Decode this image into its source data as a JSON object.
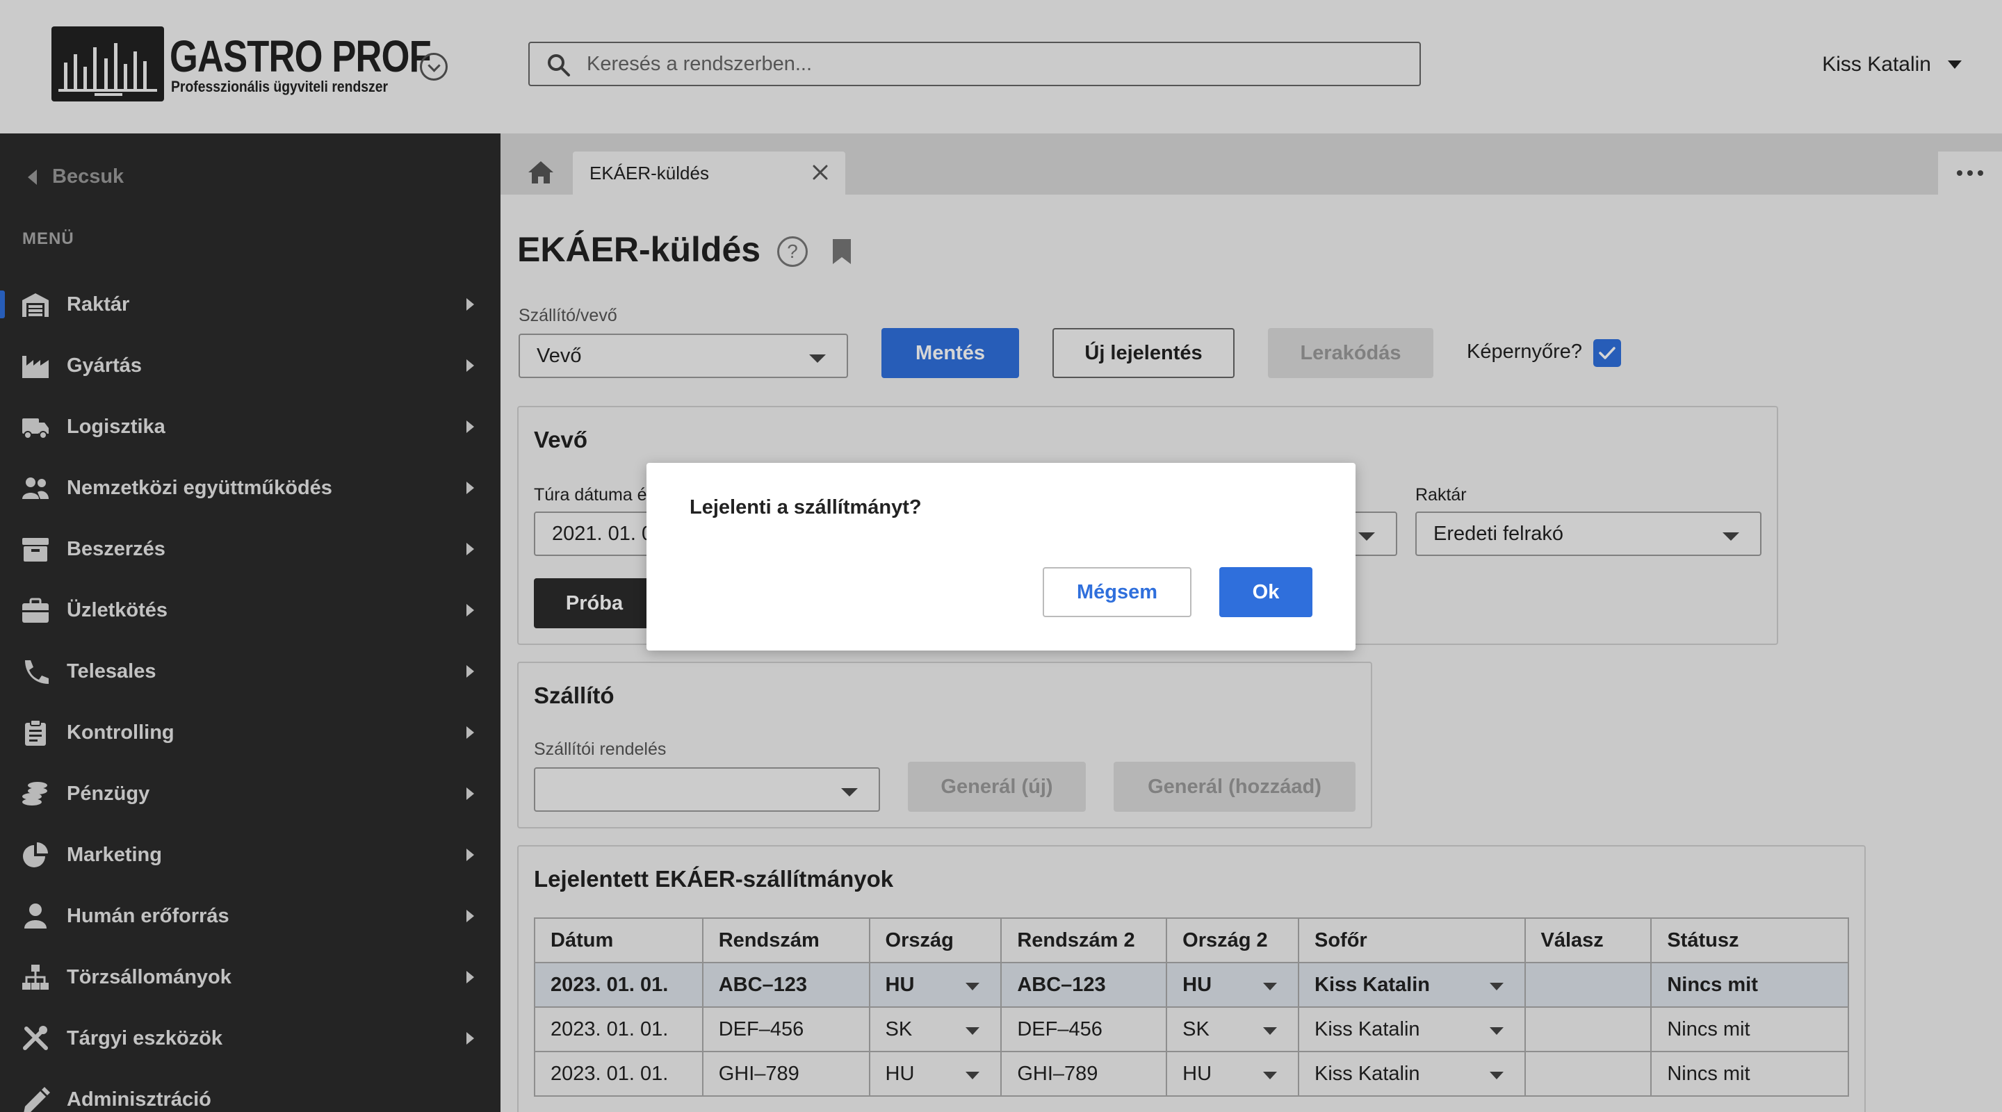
{
  "header": {
    "logo_title": "GASTRO PROF",
    "logo_subtitle": "Professzionális ügyviteli rendszer",
    "search_placeholder": "Keresés a rendszerben...",
    "user_name": "Kiss Katalin"
  },
  "sidebar": {
    "collapse_label": "Becsuk",
    "menu_label": "MENÜ",
    "items": [
      {
        "label": "Raktár",
        "icon": "warehouse-icon",
        "active": true
      },
      {
        "label": "Gyártás",
        "icon": "factory-icon"
      },
      {
        "label": "Logisztika",
        "icon": "truck-icon"
      },
      {
        "label": "Nemzetközi együttműködés",
        "icon": "users-icon"
      },
      {
        "label": "Beszerzés",
        "icon": "box-icon"
      },
      {
        "label": "Üzletkötés",
        "icon": "briefcase-icon"
      },
      {
        "label": "Telesales",
        "icon": "phone-icon"
      },
      {
        "label": "Kontrolling",
        "icon": "clipboard-icon"
      },
      {
        "label": "Pénzügy",
        "icon": "coins-icon"
      },
      {
        "label": "Marketing",
        "icon": "pie-chart-icon"
      },
      {
        "label": "Humán erőforrás",
        "icon": "user-icon"
      },
      {
        "label": "Törzsállományok",
        "icon": "hierarchy-icon"
      },
      {
        "label": "Tárgyi eszközök",
        "icon": "tools-icon"
      },
      {
        "label": "Adminisztráció",
        "icon": "pencil-icon"
      }
    ]
  },
  "tabs": {
    "active_tab": "EKÁER-küldés"
  },
  "page": {
    "title": "EKÁER-küldés",
    "supplier_customer_label": "Szállító/vevő",
    "supplier_customer_value": "Vevő",
    "save_label": "Mentés",
    "new_report_label": "Új lejelentés",
    "unload_label": "Lerakódás",
    "screen_label": "Képernyőre?",
    "screen_checked": true
  },
  "customer_panel": {
    "title": "Vevő",
    "tour_date_label": "Túra dátuma é",
    "tour_date_value": "2021. 01. 0",
    "warehouse_label": "Raktár",
    "warehouse_value": "Eredeti felrakó",
    "test_button": "Próba"
  },
  "supplier_panel": {
    "title": "Szállító",
    "order_label": "Szállítói rendelés",
    "order_value": "",
    "generate_new": "Generál (új)",
    "generate_add": "Generál (hozzáad)"
  },
  "shipments": {
    "title": "Lejelentett EKÁER-szállítmányok",
    "columns": [
      "Dátum",
      "Rendszám",
      "Ország",
      "Rendszám 2",
      "Ország 2",
      "Sofőr",
      "Válasz",
      "Státusz"
    ],
    "rows": [
      [
        "2023. 01. 01.",
        "ABC–123",
        "HU",
        "ABC–123",
        "HU",
        "Kiss Katalin",
        "",
        "Nincs mit"
      ],
      [
        "2023. 01. 01.",
        "DEF–456",
        "SK",
        "DEF–456",
        "SK",
        "Kiss Katalin",
        "",
        "Nincs mit"
      ],
      [
        "2023. 01. 01.",
        "GHI–789",
        "HU",
        "GHI–789",
        "HU",
        "Kiss Katalin",
        "",
        "Nincs mit"
      ]
    ]
  },
  "dialog": {
    "message": "Lejelenti a szállítmányt?",
    "cancel_label": "Mégsem",
    "ok_label": "Ok"
  },
  "colors": {
    "primary": "#2f6fdc",
    "sidebar_bg": "#2b2b2b",
    "header_bg": "#f2f2f2"
  }
}
